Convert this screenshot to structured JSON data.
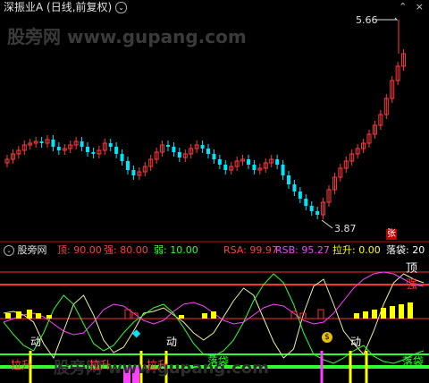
{
  "top_panel": {
    "title": "深振业A",
    "subtitle": "(日线,前复权)",
    "watermark": "股旁网 www.gupang.com",
    "high_label": "5.66",
    "low_label": "3.87",
    "corner_tag": "张",
    "colors": {
      "up": "#ff3a3a",
      "down": "#00e5ff"
    }
  },
  "bottom_panel": {
    "name": "股旁网",
    "params": [
      {
        "label": "顶: 90.00",
        "color": "#ff4040"
      },
      {
        "label": "强: 80.00",
        "color": "#ff4040"
      },
      {
        "label": "弱: 10.00",
        "color": "#30ff30"
      },
      {
        "label": "RSA: 99.97",
        "color": "#ff4040"
      },
      {
        "label": "RSB: 95.27",
        "color": "#ff40ff"
      },
      {
        "label": "拉升: 0.00",
        "color": "#ffff00"
      },
      {
        "label": "落袋: 20",
        "color": "#ffffff"
      }
    ],
    "right_labels": [
      {
        "text": "顶",
        "color": "#ffffff"
      },
      {
        "text": "强",
        "color": "#ff3030"
      }
    ],
    "signals": {
      "dong": "动",
      "lasheng": "拉升",
      "luodai": "落袋"
    },
    "watermark": "股旁网 www.gupang.com"
  }
}
